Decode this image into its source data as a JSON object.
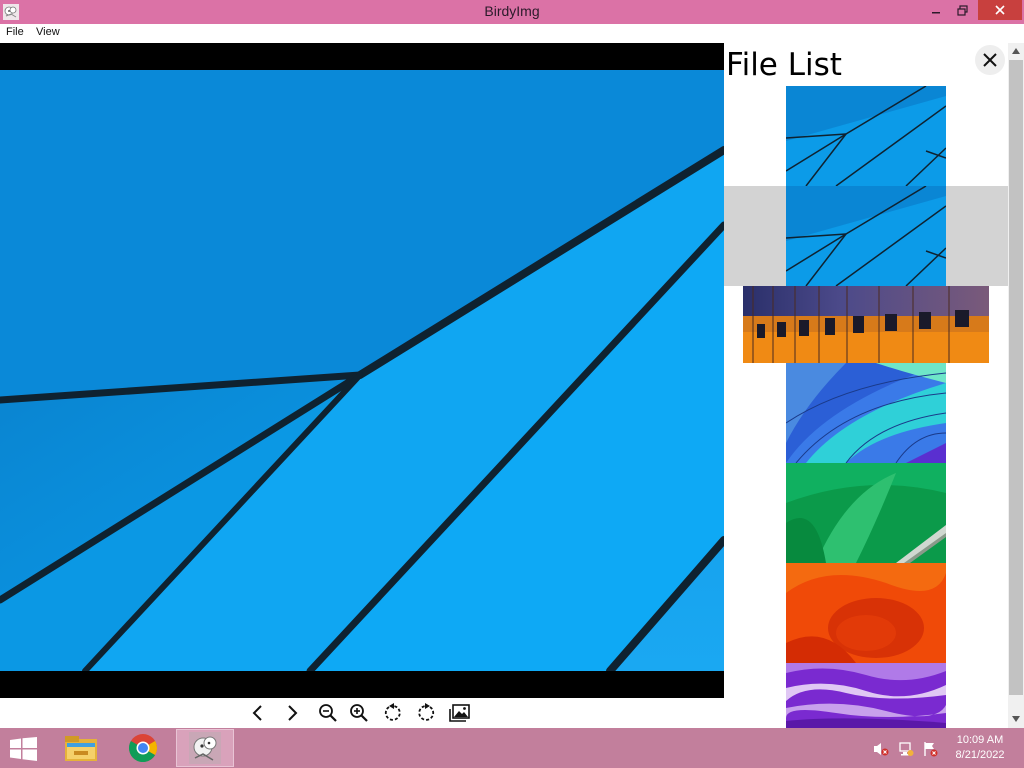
{
  "window": {
    "title": "BirdyImg",
    "controls": [
      "minimize-icon",
      "restore-icon",
      "close-icon"
    ]
  },
  "menu": {
    "file_label": "File",
    "view_label": "View"
  },
  "viewer": {
    "image": "current-image-blue-windows-wallpaper"
  },
  "toolbar": {
    "buttons": [
      "chevron-left-icon",
      "chevron-right-icon",
      "zoom-out-icon",
      "zoom-in-icon",
      "rotate-left-icon",
      "rotate-right-icon",
      "gallery-icon"
    ]
  },
  "file_list": {
    "title": "File List",
    "close_icon": "close-icon",
    "thumbnails": [
      {
        "name": "thumb-blue-lines-1",
        "selected": false
      },
      {
        "name": "thumb-blue-lines-2",
        "selected": true
      },
      {
        "name": "thumb-orange-building",
        "selected": false
      },
      {
        "name": "thumb-balloon",
        "selected": false
      },
      {
        "name": "thumb-green-wave",
        "selected": false
      },
      {
        "name": "thumb-orange-swirl",
        "selected": false
      },
      {
        "name": "thumb-purple-waves",
        "selected": false
      }
    ]
  },
  "taskbar": {
    "apps": [
      "file-explorer-icon",
      "chrome-icon",
      "birdyimg-icon"
    ],
    "tray": [
      "volume-muted-icon",
      "network-icon",
      "action-center-icon"
    ],
    "time": "10:09 AM",
    "date": "8/21/2022"
  },
  "colors": {
    "titlebar": "#db72a6",
    "taskbar": "#c27f9c",
    "close_button": "#c8403e",
    "selected_row": "#d3d3d3"
  }
}
